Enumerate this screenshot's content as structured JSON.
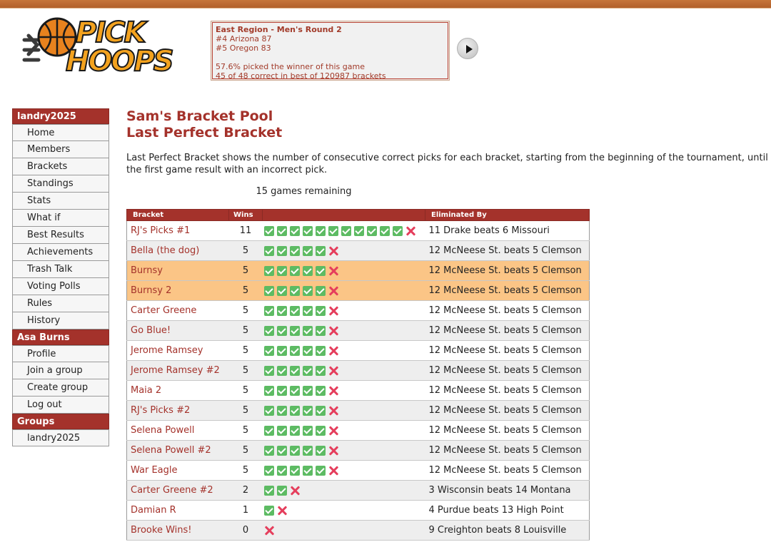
{
  "logo": {
    "line1": "PICK",
    "line2": "HOOPS"
  },
  "ticker": {
    "title": "East Region - Men's Round 2",
    "team1": "#4 Arizona 87",
    "team2": "#5 Oregon 83",
    "picked": "57.6% picked the winner of this game",
    "correct": "45 of 48 correct in best of 120987 brackets"
  },
  "sidebar": {
    "user_heading": "landry2025",
    "user_items": [
      "Home",
      "Members",
      "Brackets",
      "Standings",
      "Stats",
      "What if",
      "Best Results",
      "Achievements",
      "Trash Talk",
      "Voting Polls",
      "Rules",
      "History"
    ],
    "account_heading": "Asa Burns",
    "account_items": [
      "Profile",
      "Join a group",
      "Create group",
      "Log out"
    ],
    "groups_heading": "Groups",
    "groups_items": [
      "landry2025"
    ]
  },
  "page": {
    "title1": "Sam's Bracket Pool",
    "title2": "Last Perfect Bracket",
    "description": "Last Perfect Bracket shows the number of consecutive correct picks for each bracket, starting from the beginning of the tournament, until the first game result with an incorrect pick.",
    "remaining": "15 games remaining"
  },
  "table": {
    "headers": {
      "bracket": "Bracket",
      "wins": "Wins",
      "eliminated": "Eliminated By"
    },
    "rows": [
      {
        "name": "RJ's Picks #1",
        "wins": "11",
        "correct": 11,
        "eliminated": "11 Drake beats 6 Missouri",
        "highlight": false
      },
      {
        "name": "Bella (the dog)",
        "wins": "5",
        "correct": 5,
        "eliminated": "12 McNeese St. beats 5 Clemson",
        "highlight": false
      },
      {
        "name": "Burnsy",
        "wins": "5",
        "correct": 5,
        "eliminated": "12 McNeese St. beats 5 Clemson",
        "highlight": true
      },
      {
        "name": "Burnsy 2",
        "wins": "5",
        "correct": 5,
        "eliminated": "12 McNeese St. beats 5 Clemson",
        "highlight": true
      },
      {
        "name": "Carter Greene",
        "wins": "5",
        "correct": 5,
        "eliminated": "12 McNeese St. beats 5 Clemson",
        "highlight": false
      },
      {
        "name": "Go Blue!",
        "wins": "5",
        "correct": 5,
        "eliminated": "12 McNeese St. beats 5 Clemson",
        "highlight": false
      },
      {
        "name": "Jerome Ramsey",
        "wins": "5",
        "correct": 5,
        "eliminated": "12 McNeese St. beats 5 Clemson",
        "highlight": false
      },
      {
        "name": "Jerome Ramsey #2",
        "wins": "5",
        "correct": 5,
        "eliminated": "12 McNeese St. beats 5 Clemson",
        "highlight": false
      },
      {
        "name": "Maia 2",
        "wins": "5",
        "correct": 5,
        "eliminated": "12 McNeese St. beats 5 Clemson",
        "highlight": false
      },
      {
        "name": "RJ's Picks #2",
        "wins": "5",
        "correct": 5,
        "eliminated": "12 McNeese St. beats 5 Clemson",
        "highlight": false
      },
      {
        "name": "Selena Powell",
        "wins": "5",
        "correct": 5,
        "eliminated": "12 McNeese St. beats 5 Clemson",
        "highlight": false
      },
      {
        "name": "Selena Powell #2",
        "wins": "5",
        "correct": 5,
        "eliminated": "12 McNeese St. beats 5 Clemson",
        "highlight": false
      },
      {
        "name": "War Eagle",
        "wins": "5",
        "correct": 5,
        "eliminated": "12 McNeese St. beats 5 Clemson",
        "highlight": false
      },
      {
        "name": "Carter Greene #2",
        "wins": "2",
        "correct": 2,
        "eliminated": "3 Wisconsin beats 14 Montana",
        "highlight": false
      },
      {
        "name": "Damian R",
        "wins": "1",
        "correct": 1,
        "eliminated": "4 Purdue beats 13 High Point",
        "highlight": false
      },
      {
        "name": "Brooke Wins!",
        "wins": "0",
        "correct": 0,
        "eliminated": "9 Creighton beats 8 Louisville",
        "highlight": false
      }
    ]
  },
  "colors": {
    "accent": "#a4322b",
    "highlight_row": "#fbc586",
    "check": "#5dbb63",
    "cross": "#e53e5c"
  }
}
